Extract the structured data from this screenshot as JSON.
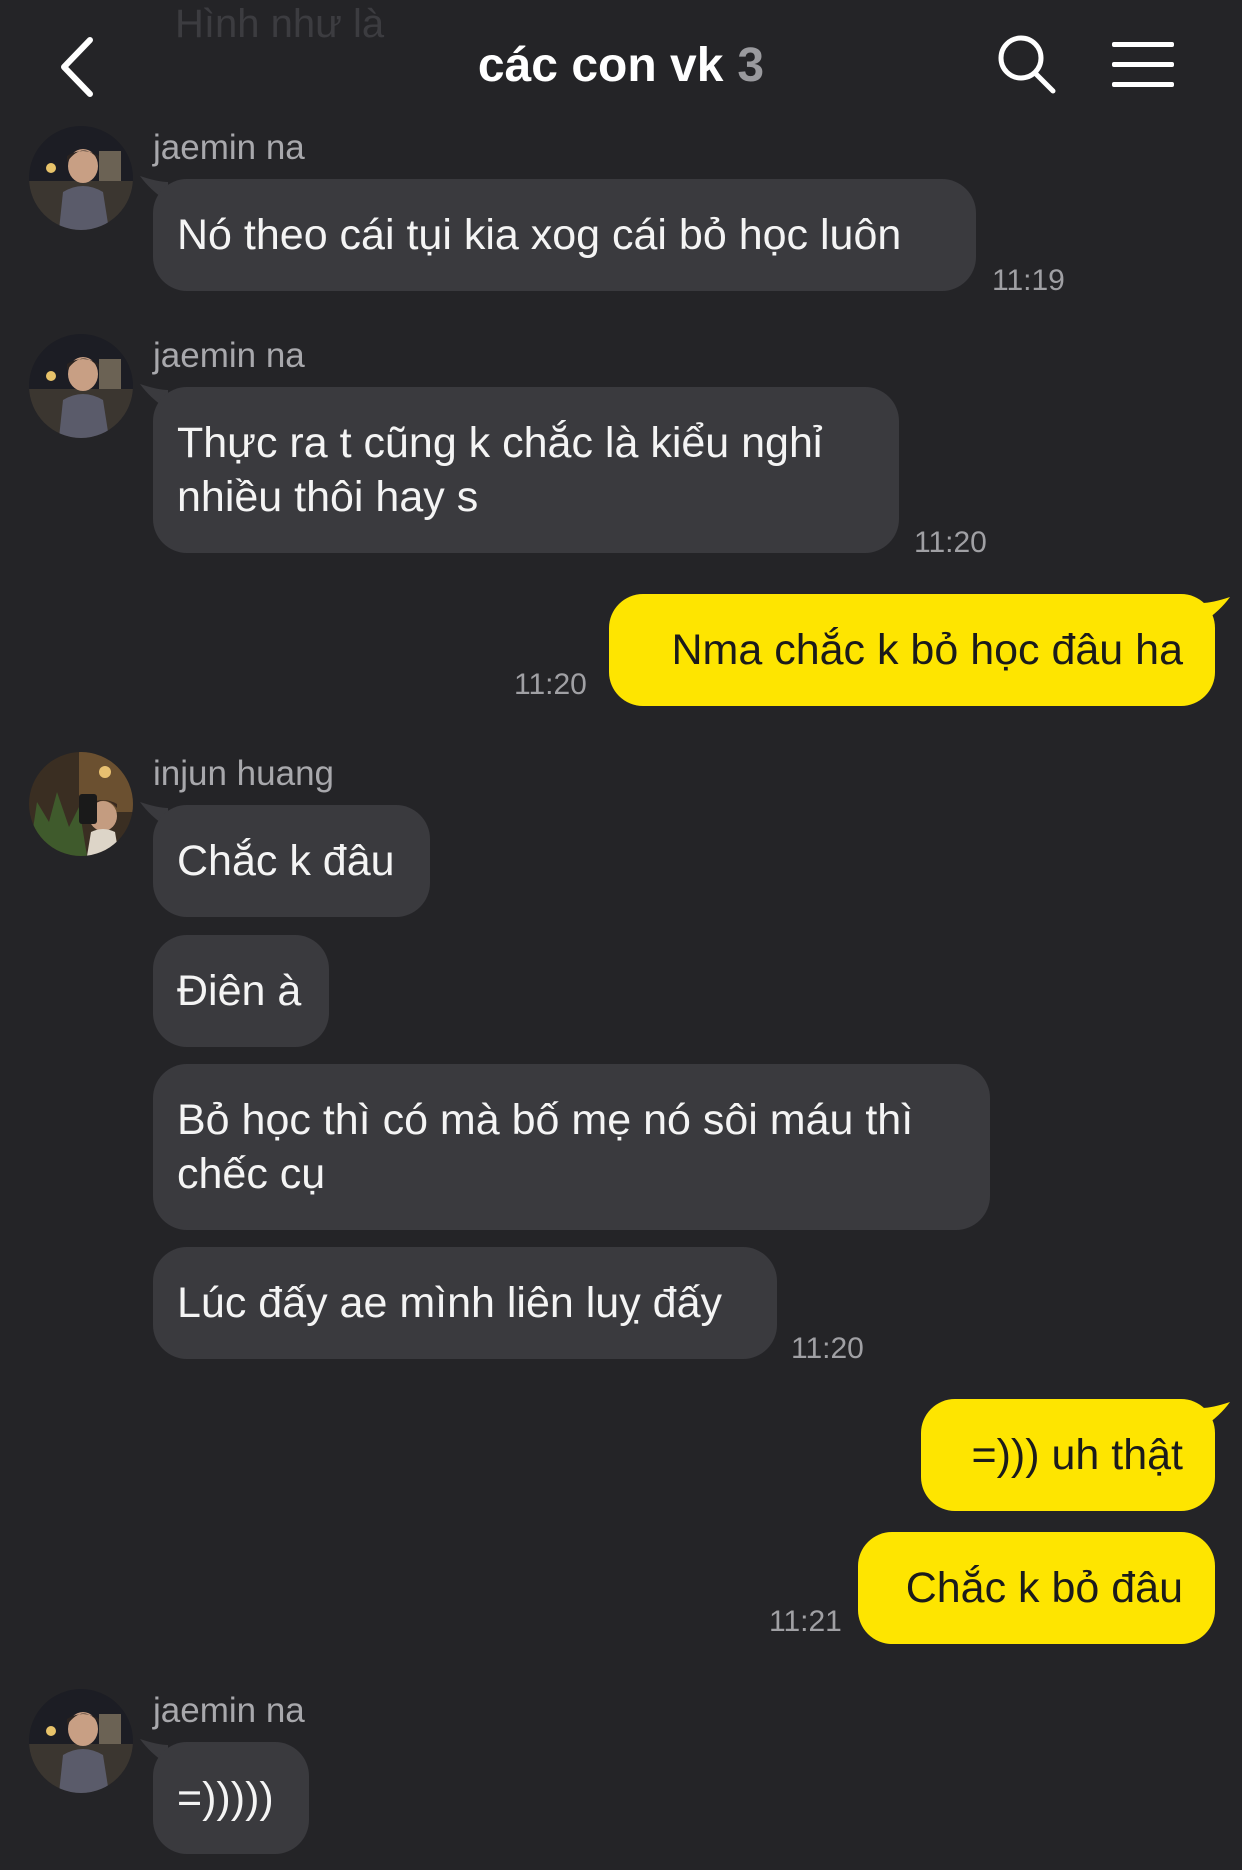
{
  "header": {
    "ghost_text": "Hình như là",
    "title": "các con vk",
    "member_count": "3",
    "back_icon": "chevron-left-icon",
    "search_icon": "search-icon",
    "menu_icon": "hamburger-menu-icon"
  },
  "colors": {
    "background": "#242427",
    "incoming_bubble": "#3a3a3e",
    "outgoing_bubble": "#fee500",
    "timestamp": "#a0a0a4"
  },
  "messages": [
    {
      "sender": "jaemin na",
      "texts": [
        "Nó theo cái tụi kia xog cái bỏ học luôn"
      ],
      "time": "11:19"
    },
    {
      "sender": "jaemin na",
      "texts": [
        "Thực ra t cũng k chắc là kiểu nghỉ",
        "nhiều thôi hay s"
      ],
      "time": "11:20"
    },
    {
      "sender": "me",
      "texts": [
        "Nma chắc k bỏ học đâu ha"
      ],
      "time": "11:20"
    },
    {
      "sender": "injun huang",
      "texts": [
        "Chắc k đâu",
        "Điên à",
        "Bỏ học thì có mà bố mẹ nó sôi máu thì",
        "chếc cụ",
        "Lúc đấy ae mình liên luỵ đấy"
      ],
      "time": "11:20"
    },
    {
      "sender": "me",
      "texts": [
        "=))) uh thật",
        "Chắc k bỏ đâu"
      ],
      "time": "11:21"
    },
    {
      "sender": "jaemin na",
      "texts": [
        "=)))))"
      ]
    }
  ]
}
